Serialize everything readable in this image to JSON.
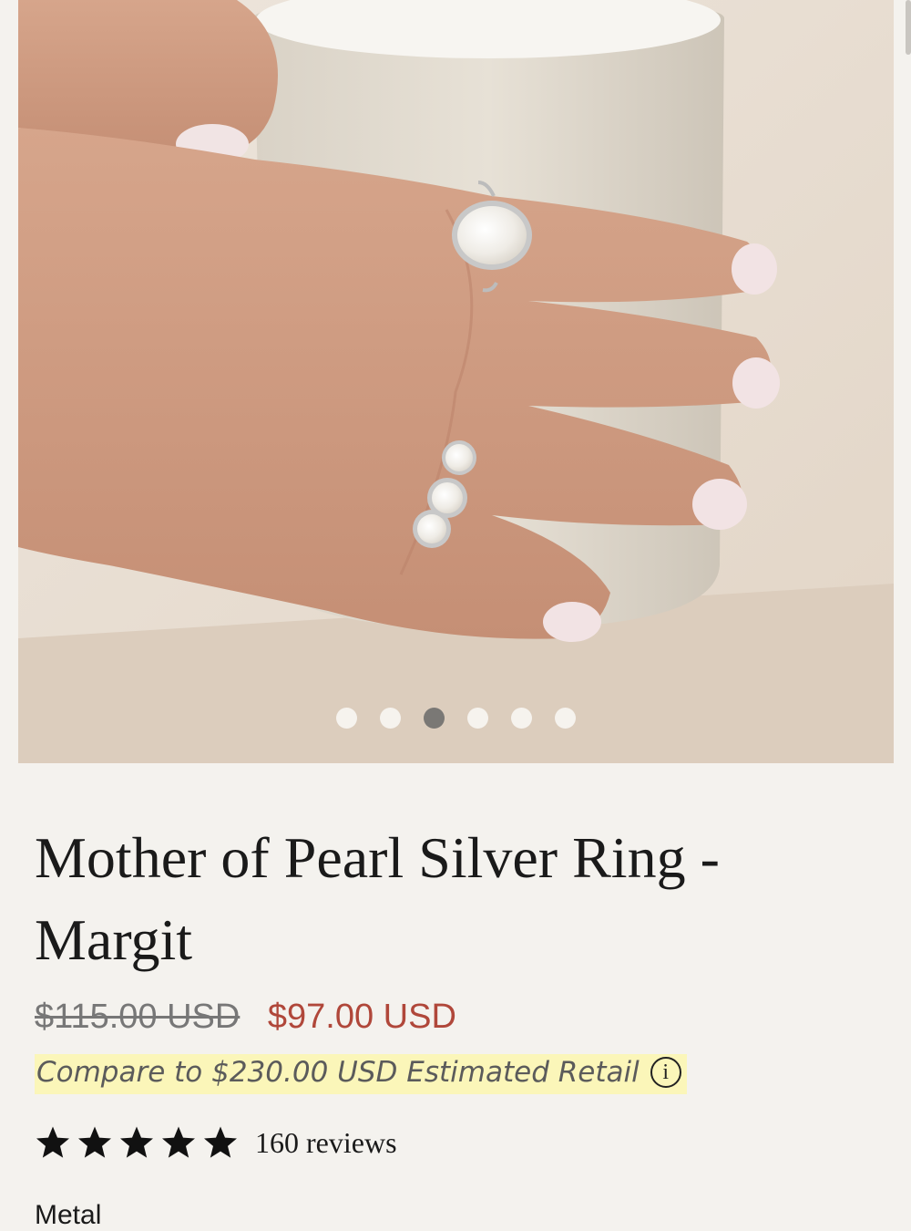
{
  "gallery": {
    "image_alt": "Hand wearing Mother of Pearl Silver Ring holding a ceramic cup",
    "dot_count": 6,
    "active_index": 2
  },
  "product": {
    "title": "Mother of Pearl Silver Ring - Margit",
    "price_original": "$115.00 USD",
    "price_sale": "$97.00 USD",
    "compare_text": "Compare to $230.00 USD Estimated Retail",
    "info_icon_glyph": "i",
    "rating_stars": 5,
    "reviews_text": "160 reviews",
    "option_label": "Metal"
  },
  "colors": {
    "sale_price": "#b0473a",
    "compare_highlight": "#fbf6b9",
    "background": "#f4f2ee"
  },
  "icons": {
    "star": "star-icon",
    "info": "info-icon"
  }
}
